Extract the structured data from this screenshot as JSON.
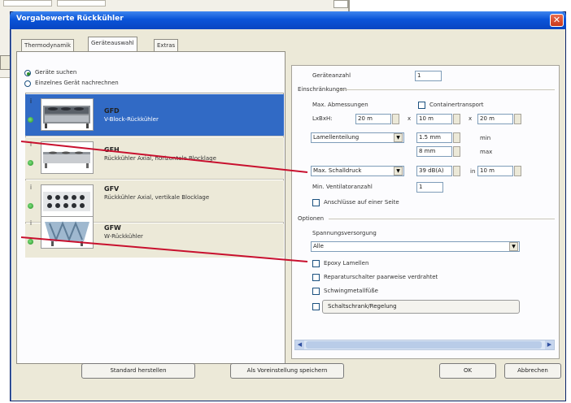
{
  "background": {
    "side_text_lines": [
      "l",
      "l",
      "e",
      "n",
      "s"
    ]
  },
  "dialog": {
    "title": "Vorgabewerte Rückkühler",
    "close_symbol": "✕"
  },
  "tabs": [
    {
      "label": "Thermodynamik"
    },
    {
      "label": "Geräteauswahl"
    },
    {
      "label": "Extras"
    }
  ],
  "search": {
    "option_search": "Geräte suchen",
    "option_single": "Einzelnes Gerät nachrechnen"
  },
  "devices": [
    {
      "code": "GFD",
      "description": "V-Block-Rückkühler",
      "info": "i",
      "selected": true
    },
    {
      "code": "GFH",
      "description": "Rückkühler Axial, horizontale Blocklage",
      "info": "i",
      "selected": false
    },
    {
      "code": "GFV",
      "description": "Rückkühler Axial, vertikale Blocklage",
      "info": "i",
      "selected": false
    },
    {
      "code": "GFW",
      "description": "W-Rückkühler",
      "info": "i",
      "selected": false
    }
  ],
  "right": {
    "device_count_label": "Geräteanzahl",
    "device_count_value": "1",
    "restrictions_label": "Einschränkungen",
    "max_dimensions_label": "Max. Abmessungen",
    "container_label": "Containertransport",
    "lxbxh_label": "LxBxH:",
    "length_value": "20 m",
    "width_value": "10 m",
    "height_value": "20 m",
    "x_sep": "x",
    "lamella_dropdown": "Lamellenteilung",
    "lamella_min_value": "1.5 mm",
    "lamella_min_label": "min",
    "lamella_max_value": "8 mm",
    "lamella_max_label": "max",
    "sound_dropdown": "Max. Schalldruck",
    "sound_value": "39 dB(A)",
    "sound_in_label": "in",
    "sound_distance": "10 m",
    "min_fan_label": "Min. Ventilatoranzahl",
    "min_fan_value": "1",
    "one_side_label": "Anschlüsse auf einer Seite",
    "options_label": "Optionen",
    "voltage_label": "Spannungsversorgung",
    "voltage_value": "Alle",
    "epoxy_label": "Epoxy Lamellen",
    "repair_label": "Reparaturschalter paarweise verdrahtet",
    "vibration_label": "Schwingmetallfüße",
    "cabinet_label": "Schaltschrank/Regelung"
  },
  "buttons": {
    "standard": "Standard herstellen",
    "save_default": "Als Voreinstellung speichern",
    "ok": "OK",
    "cancel": "Abbrechen"
  },
  "colors": {
    "callout_line": "#c8102e",
    "selection": "#316ac5",
    "title_bar": "#0a54d8"
  }
}
